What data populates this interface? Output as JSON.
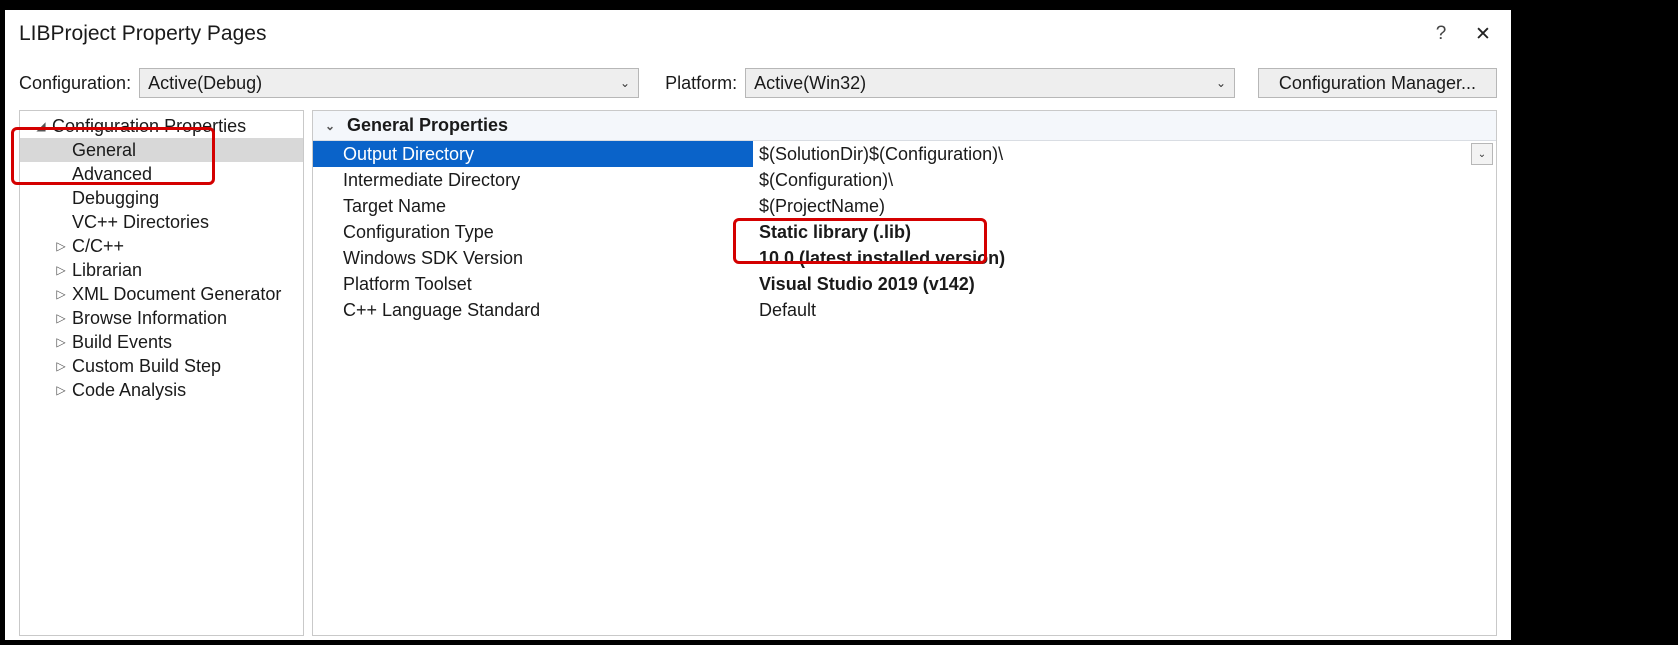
{
  "window": {
    "title": "LIBProject Property Pages",
    "help": "?",
    "close": "✕"
  },
  "toolbar": {
    "config_label": "Configuration:",
    "config_value": "Active(Debug)",
    "platform_label": "Platform:",
    "platform_value": "Active(Win32)",
    "cfg_mgr_label": "Configuration Manager..."
  },
  "tree": {
    "root": "Configuration Properties",
    "items": [
      {
        "label": "General",
        "depth": "child",
        "selected": true
      },
      {
        "label": "Advanced",
        "depth": "child"
      },
      {
        "label": "Debugging",
        "depth": "child"
      },
      {
        "label": "VC++ Directories",
        "depth": "child"
      },
      {
        "label": "C/C++",
        "expandable": true
      },
      {
        "label": "Librarian",
        "expandable": true
      },
      {
        "label": "XML Document Generator",
        "expandable": true
      },
      {
        "label": "Browse Information",
        "expandable": true
      },
      {
        "label": "Build Events",
        "expandable": true
      },
      {
        "label": "Custom Build Step",
        "expandable": true
      },
      {
        "label": "Code Analysis",
        "expandable": true
      }
    ]
  },
  "properties": {
    "group_title": "General Properties",
    "rows": [
      {
        "key": "Output Directory",
        "val": "$(SolutionDir)$(Configuration)\\",
        "selected": true,
        "dropdown": true
      },
      {
        "key": "Intermediate Directory",
        "val": "$(Configuration)\\"
      },
      {
        "key": "Target Name",
        "val": "$(ProjectName)"
      },
      {
        "key": "Configuration Type",
        "val": "Static library (.lib)",
        "bold": true
      },
      {
        "key": "Windows SDK Version",
        "val": "10.0 (latest installed version)",
        "bold": true
      },
      {
        "key": "Platform Toolset",
        "val": "Visual Studio 2019 (v142)",
        "bold": true
      },
      {
        "key": "C++ Language Standard",
        "val": "Default"
      }
    ]
  }
}
